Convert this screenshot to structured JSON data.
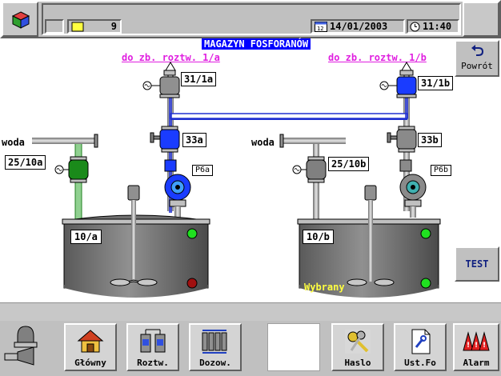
{
  "header": {
    "counter": "9",
    "date": "14/01/2003",
    "time": "11:40"
  },
  "title": "MAGAZYN FOSFORANÓW",
  "back_button": {
    "label": "Powrót"
  },
  "test_button": {
    "label": "TEST"
  },
  "links": {
    "left": "do zb. roztw. 1/a",
    "right": "do zb. roztw. 1/b"
  },
  "water": {
    "left": "woda",
    "right": "woda"
  },
  "valves": {
    "v31_1a": "31/1a",
    "v31_1b": "31/1b",
    "v33a": "33a",
    "v33b": "33b",
    "v25_10a": "25/10a",
    "v25_10b": "25/10b"
  },
  "pumps": {
    "p6a": "P6a",
    "p6b": "P6b"
  },
  "tanks": {
    "left": {
      "label": "10/a"
    },
    "right": {
      "label": "10/b",
      "status": "Wybrany"
    }
  },
  "bottom_buttons": {
    "glowny": "Główny",
    "roztw": "Roztw.",
    "dozow": "Dozow.",
    "haslo": "Haslo",
    "ustfo": "Ust.Fo",
    "alarm": "Alarm"
  },
  "colors": {
    "valve_active_blue": "#1a3cff",
    "valve_green": "#1a8a1a",
    "valve_gray": "#808080",
    "pipe_blue": "#2030d0",
    "title_bg": "#0000ff",
    "link_magenta": "#e020e0",
    "led_green": "#20e020",
    "led_red": "#a01010"
  }
}
